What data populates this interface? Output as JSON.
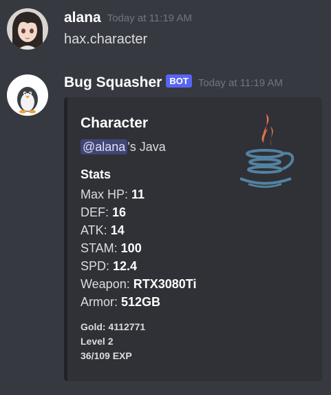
{
  "messages": [
    {
      "username": "alana",
      "timestamp": "Today at 11:19 AM",
      "content": "hax.character"
    },
    {
      "username": "Bug Squasher",
      "bot_tag": "BOT",
      "timestamp": "Today at 11:19 AM",
      "embed": {
        "title": "Character",
        "mention": "@alana",
        "mention_suffix": "'s Java",
        "stats_title": "Stats",
        "stats": [
          {
            "label": "Max HP: ",
            "value": "11"
          },
          {
            "label": "DEF: ",
            "value": "16"
          },
          {
            "label": "ATK: ",
            "value": "14"
          },
          {
            "label": "STAM: ",
            "value": "100"
          },
          {
            "label": "SPD: ",
            "value": "12.4"
          },
          {
            "label": "Weapon: ",
            "value": "RTX3080Ti"
          },
          {
            "label": "Armor: ",
            "value": "512GB"
          }
        ],
        "footer": [
          "Gold: 4112771",
          "Level 2",
          "36/109 EXP"
        ],
        "thumbnail_icon": "java-logo-icon"
      }
    }
  ],
  "colors": {
    "background": "#36393f",
    "embed_background": "#2f3136",
    "bot_tag": "#5865f2",
    "mention_background": "#414675",
    "java_red": "#e76f51",
    "java_blue": "#5382a1"
  }
}
